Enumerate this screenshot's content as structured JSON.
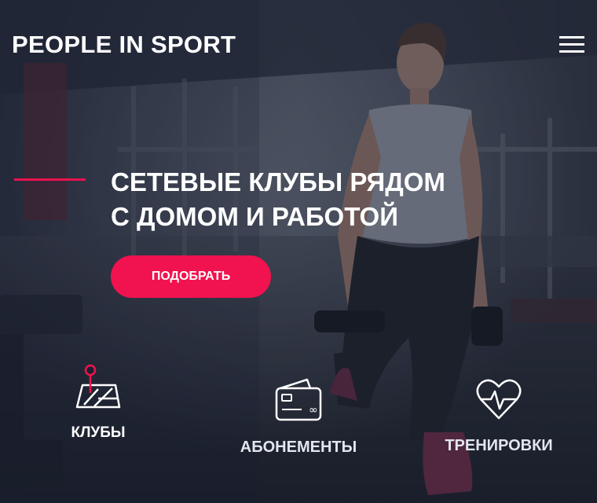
{
  "header": {
    "brand": "PEOPLE IN SPORT",
    "menu_icon": "hamburger-menu-icon"
  },
  "hero": {
    "headline_line1": "СЕТЕВЫЕ КЛУБЫ РЯДОМ",
    "headline_line2": "С ДОМОМ И РАБОТОЙ",
    "cta_label": "ПОДОБРАТЬ"
  },
  "features": [
    {
      "label": "КЛУБЫ",
      "icon": "map-pin-icon"
    },
    {
      "label": "АБОНЕМЕНТЫ",
      "icon": "membership-card-icon"
    },
    {
      "label": "ТРЕНИРОВКИ",
      "icon": "heart-pulse-icon"
    }
  ],
  "colors": {
    "accent": "#f0134f",
    "overlay": "#1c2230",
    "text": "#ffffff"
  }
}
